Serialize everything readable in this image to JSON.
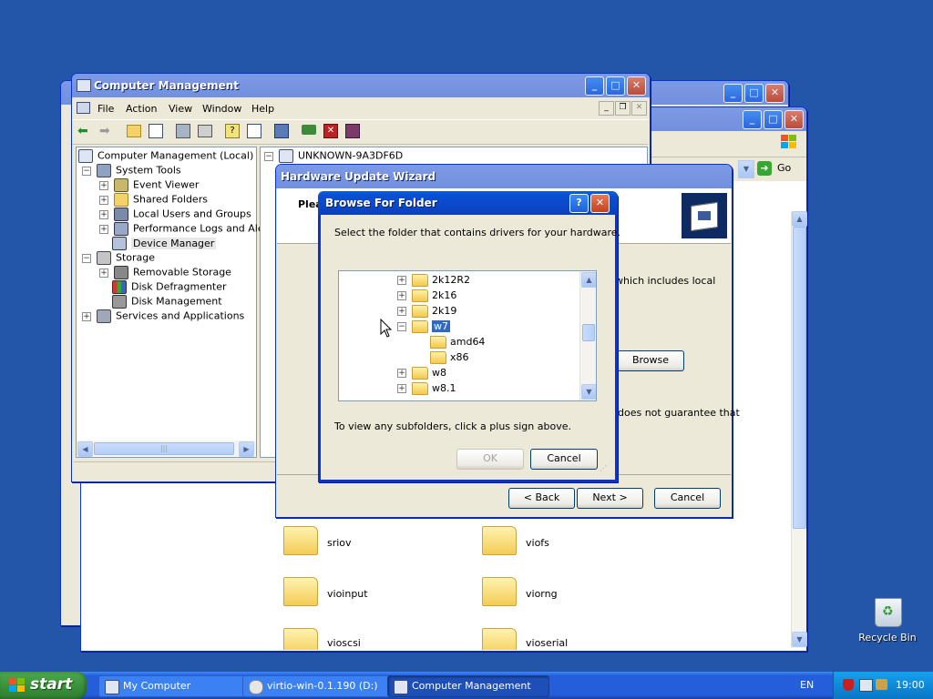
{
  "desktop": {
    "recycle_bin_label": "Recycle Bin"
  },
  "computer_management": {
    "title": "Computer Management",
    "menu": [
      "File",
      "Action",
      "View",
      "Window",
      "Help"
    ],
    "tree": [
      {
        "label": "Computer Management (Local)",
        "indent": 0
      },
      {
        "label": "System Tools",
        "indent": 1
      },
      {
        "label": "Event Viewer",
        "indent": 2
      },
      {
        "label": "Shared Folders",
        "indent": 2
      },
      {
        "label": "Local Users and Groups",
        "indent": 2
      },
      {
        "label": "Performance Logs and Alerts",
        "indent": 2
      },
      {
        "label": "Device Manager",
        "indent": 2
      },
      {
        "label": "Storage",
        "indent": 1
      },
      {
        "label": "Removable Storage",
        "indent": 2
      },
      {
        "label": "Disk Defragmenter",
        "indent": 2
      },
      {
        "label": "Disk Management",
        "indent": 2
      },
      {
        "label": "Services and Applications",
        "indent": 1
      }
    ],
    "right_pane_root": "UNKNOWN-9A3DF6D"
  },
  "explorer": {
    "go_label": "Go",
    "folders": [
      "sriov",
      "viofs",
      "vioinput",
      "viorng",
      "vioscsi",
      "vioserial"
    ]
  },
  "wizard": {
    "title": "Hardware Update Wizard",
    "header_fragment": "Plea",
    "text_fragment_1": "which includes local",
    "text_fragment_2": "does not guarantee that",
    "browse_label": "Browse",
    "back_label": "< Back",
    "next_label": "Next >",
    "cancel_label": "Cancel"
  },
  "browse_dialog": {
    "title": "Browse For Folder",
    "help_icon": "?",
    "prompt": "Select the folder that contains drivers for your hardware.",
    "tree_items": [
      "2k12R2",
      "2k16",
      "2k19",
      "w7",
      "amd64",
      "x86",
      "w8",
      "w8.1"
    ],
    "selected_item": "w7",
    "hint": "To view any subfolders, click a plus sign above.",
    "ok_label": "OK",
    "cancel_label": "Cancel"
  },
  "taskbar": {
    "start_label": "start",
    "items": [
      "My Computer",
      "virtio-win-0.1.190 (D:)",
      "Computer Management"
    ],
    "language": "EN",
    "clock": "19:00"
  }
}
